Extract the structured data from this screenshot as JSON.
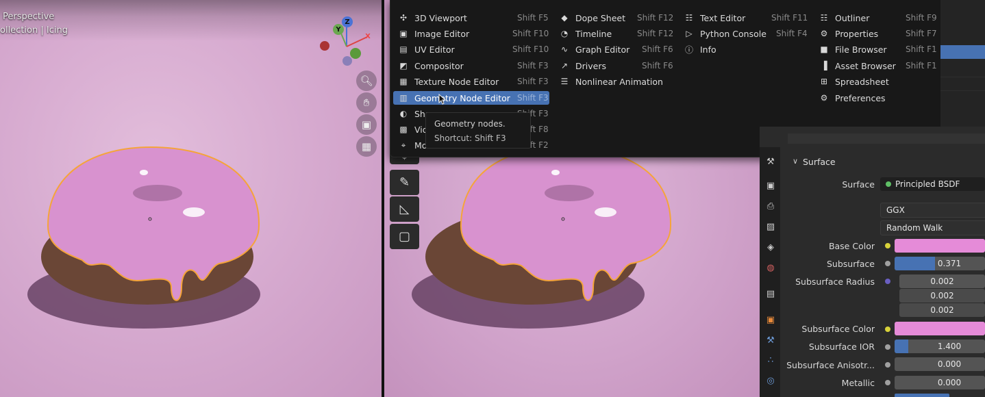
{
  "viewport_left": {
    "line1": "Perspective",
    "line2": "ollection | Icing"
  },
  "gizmo": {
    "z": "Z",
    "y": "Y",
    "x": "X"
  },
  "nav_buttons": [
    "zoom-icon",
    "hand-icon",
    "camera-icon",
    "grid-icon"
  ],
  "menu": {
    "col1": [
      {
        "label": "3D Viewport",
        "shortcut": "Shift F5",
        "icon": "viewport-icon"
      },
      {
        "label": "Image Editor",
        "shortcut": "Shift F10",
        "icon": "image-icon"
      },
      {
        "label": "UV Editor",
        "shortcut": "Shift F10",
        "icon": "uv-icon"
      },
      {
        "label": "Compositor",
        "shortcut": "Shift F3",
        "icon": "compositor-icon"
      },
      {
        "label": "Texture Node Editor",
        "shortcut": "Shift F3",
        "icon": "texture-icon"
      },
      {
        "label": "Geometry Node Editor",
        "shortcut": "Shift F3",
        "icon": "geometry-nodes-icon"
      },
      {
        "label": "Sha",
        "shortcut": "Shift F3",
        "icon": "shader-icon"
      },
      {
        "label": "Vid",
        "shortcut": "Shift F8",
        "icon": "video-icon"
      },
      {
        "label": "Mo",
        "shortcut": "Shift F2",
        "icon": "movie-clip-icon"
      }
    ],
    "col2": [
      {
        "label": "Dope Sheet",
        "shortcut": "Shift F12",
        "icon": "dopesheet-icon"
      },
      {
        "label": "Timeline",
        "shortcut": "Shift F12",
        "icon": "timeline-icon"
      },
      {
        "label": "Graph Editor",
        "shortcut": "Shift F6",
        "icon": "graph-icon"
      },
      {
        "label": "Drivers",
        "shortcut": "Shift F6",
        "icon": "drivers-icon"
      },
      {
        "label": "Nonlinear Animation",
        "shortcut": "",
        "icon": "nla-icon"
      }
    ],
    "col3": [
      {
        "label": "Text Editor",
        "shortcut": "Shift F11",
        "icon": "text-icon"
      },
      {
        "label": "Python Console",
        "shortcut": "Shift F4",
        "icon": "console-icon"
      },
      {
        "label": "Info",
        "shortcut": "",
        "icon": "info-icon"
      }
    ],
    "col4": [
      {
        "label": "Outliner",
        "shortcut": "Shift F9",
        "icon": "outliner-icon"
      },
      {
        "label": "Properties",
        "shortcut": "Shift F7",
        "icon": "properties-icon"
      },
      {
        "label": "File Browser",
        "shortcut": "Shift F1",
        "icon": "file-browser-icon"
      },
      {
        "label": "Asset Browser",
        "shortcut": "Shift F1",
        "icon": "asset-browser-icon"
      },
      {
        "label": "Spreadsheet",
        "shortcut": "",
        "icon": "spreadsheet-icon"
      },
      {
        "label": "Preferences",
        "shortcut": "",
        "icon": "preferences-icon"
      }
    ]
  },
  "tooltip": {
    "line1": "Geometry nodes.",
    "line2": "Shortcut: Shift F3"
  },
  "properties": {
    "section": "Surface",
    "surface_label": "Surface",
    "surface_value": "Principled BSDF",
    "distribution": "GGX",
    "subsurface_method": "Random Walk",
    "base_color_label": "Base Color",
    "subsurface_label": "Subsurface",
    "subsurface_value": "0.371",
    "subsurface_fill": 0.371,
    "subsurface_radius_label": "Subsurface Radius",
    "subsurface_radius": [
      "0.002",
      "0.002",
      "0.002"
    ],
    "subsurface_color_label": "Subsurface Color",
    "subsurface_ior_label": "Subsurface IOR",
    "subsurface_ior_value": "1.400",
    "subsurface_aniso_label": "Subsurface Anisotr...",
    "subsurface_aniso_value": "0.000",
    "metallic_label": "Metallic",
    "metallic_value": "0.000"
  },
  "colors": {
    "accent": "#4772b3",
    "base_color": "#e58bd8",
    "subsurface_color": "#e58bd8",
    "icing": "#d88fcd",
    "selection_outline": "#f5a43a"
  }
}
